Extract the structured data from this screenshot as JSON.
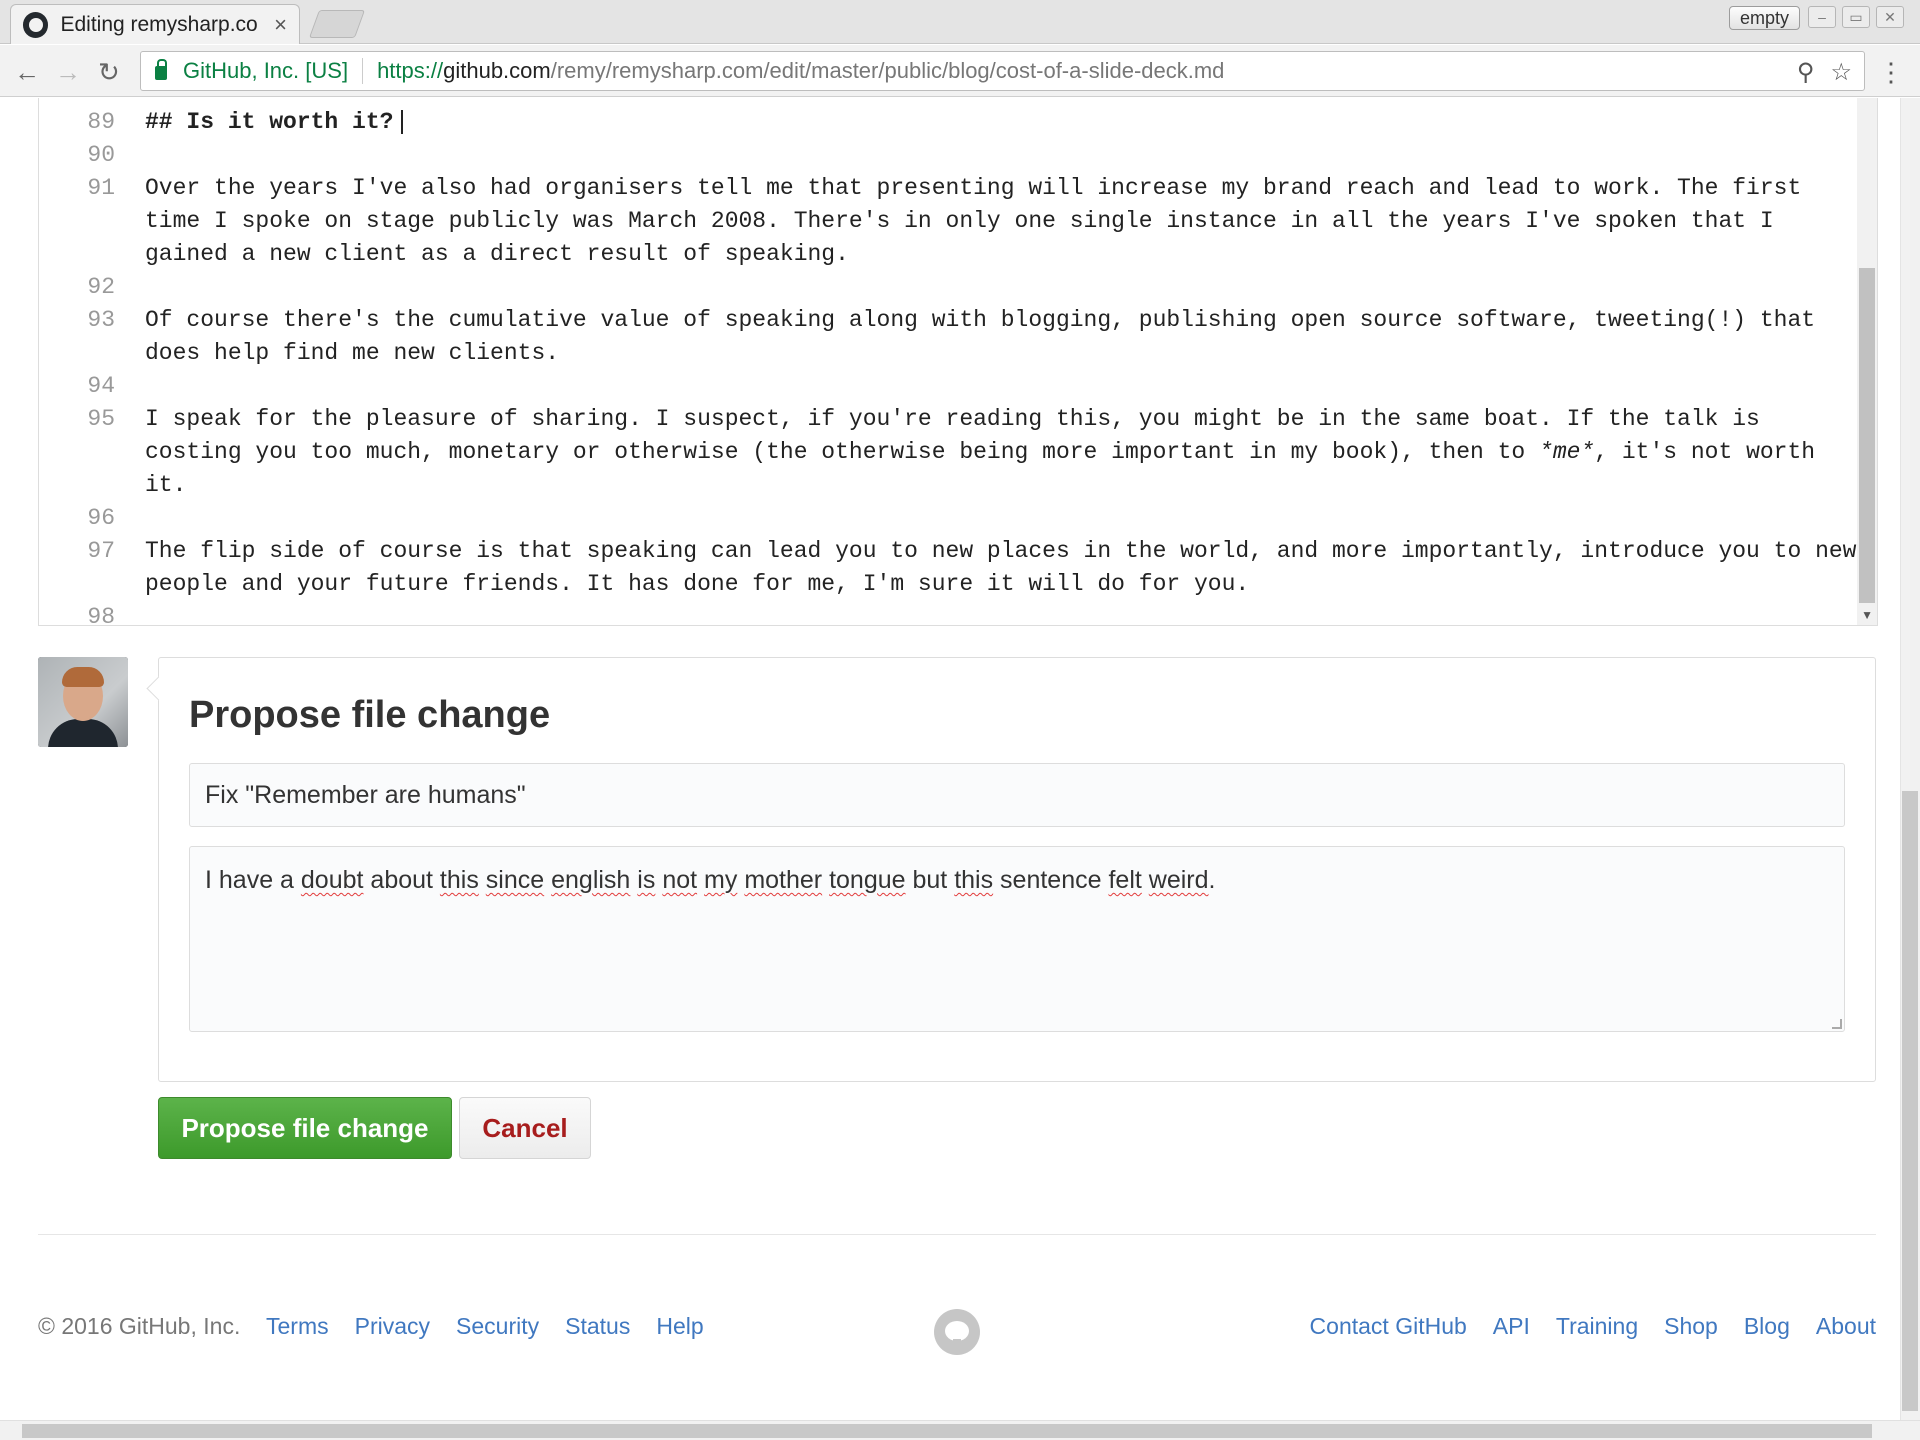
{
  "browser": {
    "tab_title": "Editing remysharp.co",
    "tab_close": "×",
    "profile_label": "empty",
    "secure_label": "GitHub, Inc. [US]",
    "url_proto": "https://",
    "url_host": "github.com",
    "url_path": "/remy/remysharp.com/edit/master/public/blog/cost-of-a-slide-deck.md",
    "icons": [
      "back-icon",
      "forward-icon",
      "reload-icon",
      "lock-icon",
      "zoom-icon",
      "star-icon",
      "menu-icon"
    ]
  },
  "editor": {
    "lines": [
      {
        "num": "89",
        "text": "## Is it worth it?"
      },
      {
        "num": "90",
        "text": ""
      },
      {
        "num": "91",
        "text": "Over the years I've also had organisers tell me that presenting will increase my brand reach and lead to work. The first time I spoke on stage publicly was March 2008. There's in only one single instance in all the years I've spoken that I gained a new client as a direct result of speaking."
      },
      {
        "num": "92",
        "text": ""
      },
      {
        "num": "93",
        "text": "Of course there's the cumulative value of speaking along with blogging, publishing open source software, tweeting(!) that does help find me new clients."
      },
      {
        "num": "94",
        "text": ""
      },
      {
        "num": "95a",
        "text": "I speak for the pleasure of sharing. I suspect, if you're reading this, you might be in the same boat. If the talk is costing you too much, monetary or otherwise (the otherwise being more important in my book), then to "
      },
      {
        "num": "95b",
        "text": "*me*"
      },
      {
        "num": "95c",
        "text": ", it's not worth it."
      },
      {
        "num": "96",
        "text": ""
      },
      {
        "num": "97",
        "text": "The flip side of course is that speaking can lead you to new places in the world, and more importantly, introduce you to new people and your future friends. It has done for me, I'm sure it will do for you."
      },
      {
        "num": "98",
        "text": ""
      }
    ]
  },
  "propose": {
    "title": "Propose file change",
    "commit_summary": "Fix \"Remember are humans\"",
    "description_parts": [
      "I have a ",
      "doubt",
      " about ",
      "this",
      " ",
      "since",
      " ",
      "english",
      " ",
      "is",
      " ",
      "not",
      " ",
      "my",
      " ",
      "mother",
      " ",
      "tongue",
      " but ",
      "this",
      " sentence ",
      "felt",
      " ",
      "weird",
      "."
    ],
    "submit_label": "Propose file change",
    "cancel_label": "Cancel"
  },
  "footer": {
    "copyright": "© 2016 GitHub, Inc.",
    "left_links": [
      "Terms",
      "Privacy",
      "Security",
      "Status",
      "Help"
    ],
    "right_links": [
      "Contact GitHub",
      "API",
      "Training",
      "Shop",
      "Blog",
      "About"
    ]
  },
  "colors": {
    "accent_green": "#3d9a2b",
    "link_blue": "#4078c0",
    "cancel_red": "#a71d1d"
  }
}
